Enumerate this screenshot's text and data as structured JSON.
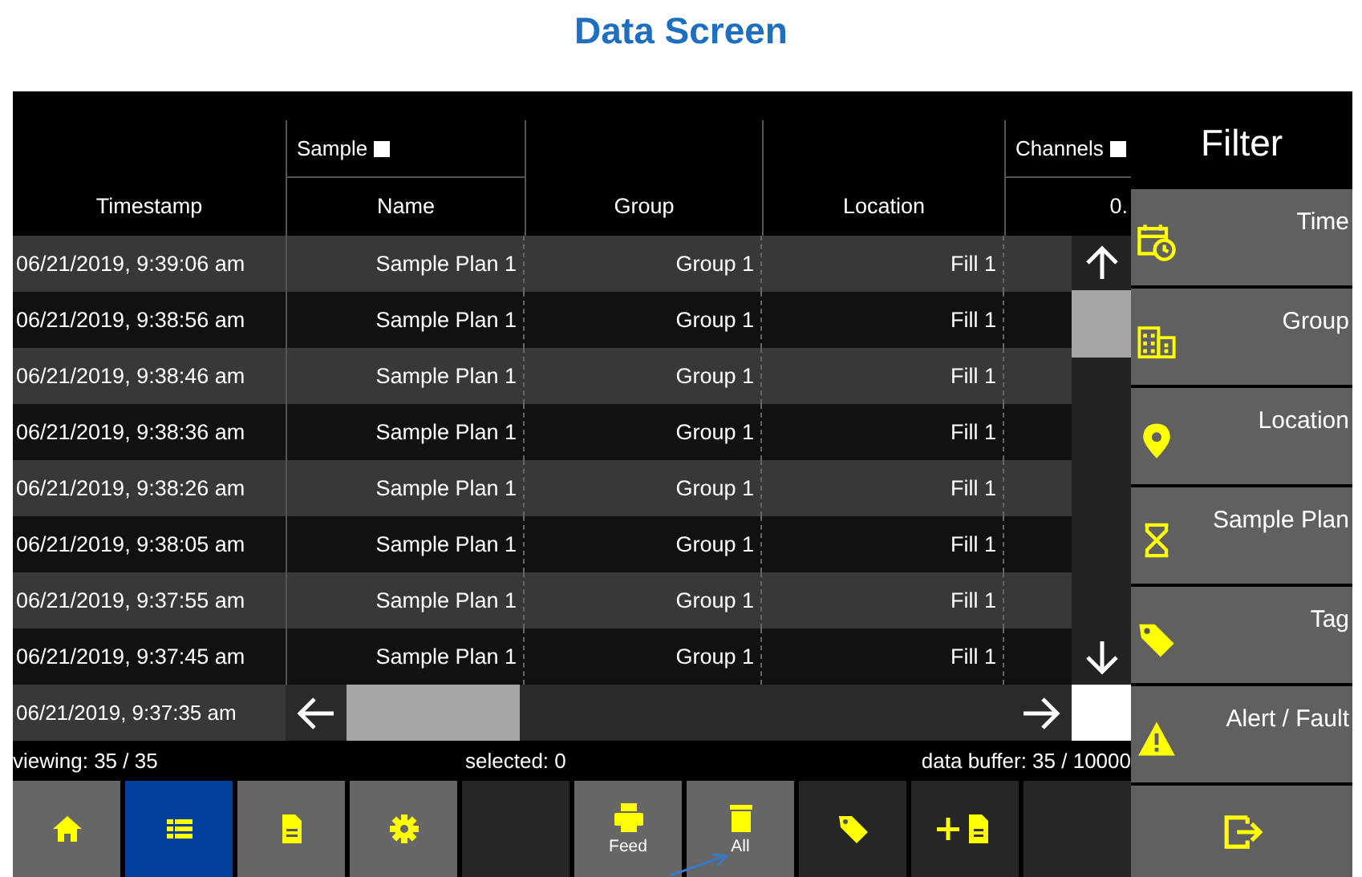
{
  "page_title": "Data Screen",
  "table": {
    "group_headers": [
      {
        "label": "Sample"
      },
      {
        "label": "Channels"
      }
    ],
    "columns": [
      "Timestamp",
      "Name",
      "Group",
      "Location",
      "0."
    ],
    "rows": [
      {
        "timestamp": "06/21/2019, 9:39:06 am",
        "name": "Sample Plan 1",
        "group": "Group 1",
        "location": "Fill 1"
      },
      {
        "timestamp": "06/21/2019, 9:38:56 am",
        "name": "Sample Plan 1",
        "group": "Group 1",
        "location": "Fill 1"
      },
      {
        "timestamp": "06/21/2019, 9:38:46 am",
        "name": "Sample Plan 1",
        "group": "Group 1",
        "location": "Fill 1"
      },
      {
        "timestamp": "06/21/2019, 9:38:36 am",
        "name": "Sample Plan 1",
        "group": "Group 1",
        "location": "Fill 1"
      },
      {
        "timestamp": "06/21/2019, 9:38:26 am",
        "name": "Sample Plan 1",
        "group": "Group 1",
        "location": "Fill 1"
      },
      {
        "timestamp": "06/21/2019, 9:38:05 am",
        "name": "Sample Plan 1",
        "group": "Group 1",
        "location": "Fill 1"
      },
      {
        "timestamp": "06/21/2019, 9:37:55 am",
        "name": "Sample Plan 1",
        "group": "Group 1",
        "location": "Fill 1"
      },
      {
        "timestamp": "06/21/2019, 9:37:45 am",
        "name": "Sample Plan 1",
        "group": "Group 1",
        "location": "Fill 1"
      }
    ],
    "partial_row": {
      "timestamp": "06/21/2019, 9:37:35 am"
    }
  },
  "status_bar": {
    "viewing": "viewing: 35 / 35",
    "selected": "selected: 0",
    "data_buffer": "data buffer: 35 / 10000"
  },
  "toolbar": [
    {
      "kind": "home",
      "selected": false,
      "disabled": false
    },
    {
      "kind": "list",
      "selected": true,
      "disabled": false
    },
    {
      "kind": "document",
      "selected": false,
      "disabled": false
    },
    {
      "kind": "settings",
      "selected": false,
      "disabled": false
    },
    {
      "kind": "blank",
      "selected": false,
      "disabled": true
    },
    {
      "kind": "feed",
      "label": "Feed",
      "selected": false,
      "disabled": false
    },
    {
      "kind": "delete",
      "label": "All",
      "selected": false,
      "disabled": false
    },
    {
      "kind": "tag",
      "selected": false,
      "disabled": true
    },
    {
      "kind": "add-document",
      "selected": false,
      "disabled": true
    },
    {
      "kind": "blank",
      "selected": false,
      "disabled": true
    }
  ],
  "filter": {
    "title": "Filter",
    "items": [
      {
        "kind": "time",
        "label": "Time"
      },
      {
        "kind": "group",
        "label": "Group"
      },
      {
        "kind": "location",
        "label": "Location"
      },
      {
        "kind": "sample-plan",
        "label": "Sample Plan"
      },
      {
        "kind": "tag",
        "label": "Tag"
      },
      {
        "kind": "alert",
        "label": "Alert / Fault"
      }
    ]
  }
}
